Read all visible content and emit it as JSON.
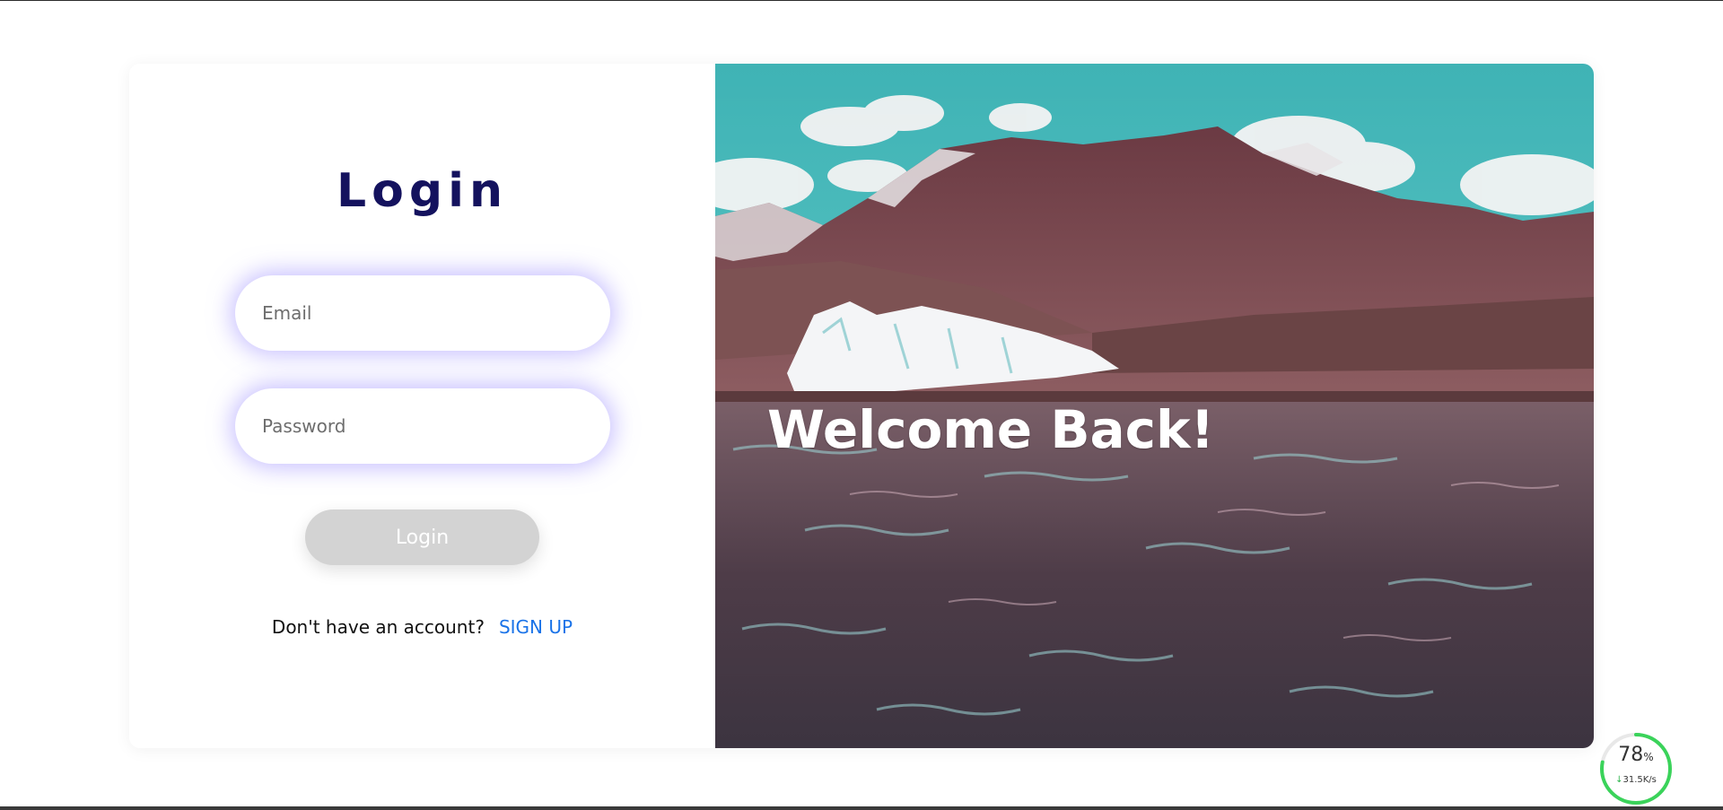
{
  "login": {
    "title": "Login",
    "email_placeholder": "Email",
    "password_placeholder": "Password",
    "submit_label": "Login",
    "signup_prompt": "Don't have an account?",
    "signup_link": "SIGN UP"
  },
  "hero": {
    "welcome_text": "Welcome Back!"
  },
  "speed_widget": {
    "percent": "78",
    "percent_unit": "%",
    "rate_arrow": "↓",
    "rate": "31.5K/s",
    "ring_fraction": 0.78
  },
  "colors": {
    "title": "#14125e",
    "link": "#1a73e8",
    "field_glow": "#9687ff",
    "button_disabled": "#d3d3d3",
    "widget_ring": "#3ad35a"
  }
}
